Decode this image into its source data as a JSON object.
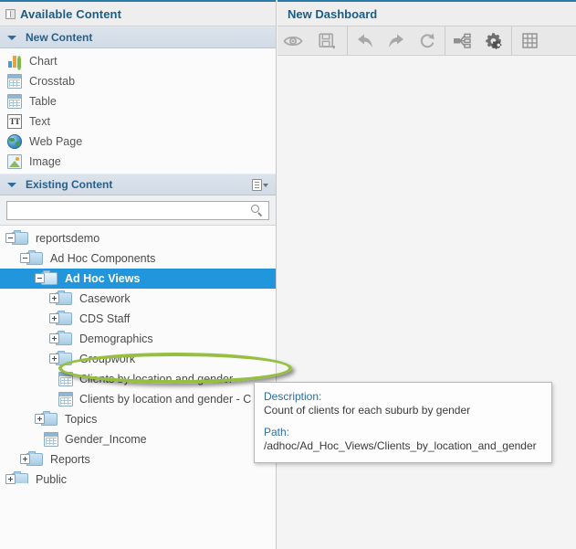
{
  "left_panel": {
    "title": "Available Content",
    "title_icon": "panel-collapse-icon",
    "new_content": {
      "header": "New Content",
      "items": [
        {
          "label": "Chart",
          "icon": "chart-icon"
        },
        {
          "label": "Crosstab",
          "icon": "crosstab-icon"
        },
        {
          "label": "Table",
          "icon": "table-icon"
        },
        {
          "label": "Text",
          "icon": "text-icon"
        },
        {
          "label": "Web Page",
          "icon": "web-page-icon"
        },
        {
          "label": "Image",
          "icon": "image-icon"
        }
      ]
    },
    "existing_content": {
      "header": "Existing Content",
      "options_icon": "list-options-icon",
      "search": {
        "value": "",
        "placeholder": "",
        "icon": "search-icon"
      },
      "tree": [
        {
          "label": "reportsdemo",
          "depth": 0,
          "type": "folder",
          "expander": "minus",
          "selected": false
        },
        {
          "label": "Ad Hoc Components",
          "depth": 1,
          "type": "folder",
          "expander": "minus",
          "selected": false
        },
        {
          "label": "Ad Hoc Views",
          "depth": 2,
          "type": "folder",
          "expander": "minus",
          "selected": true
        },
        {
          "label": "Casework",
          "depth": 3,
          "type": "folder",
          "expander": "plus",
          "selected": false
        },
        {
          "label": "CDS Staff",
          "depth": 3,
          "type": "folder",
          "expander": "plus",
          "selected": false
        },
        {
          "label": "Demographics",
          "depth": 3,
          "type": "folder",
          "expander": "plus",
          "selected": false
        },
        {
          "label": "Groupwork",
          "depth": 3,
          "type": "folder",
          "expander": "plus",
          "selected": false
        },
        {
          "label": "Clients by location and gender",
          "depth": 3,
          "type": "view",
          "expander": "none",
          "selected": false
        },
        {
          "label": "Clients by location and gender - C",
          "depth": 3,
          "type": "view",
          "expander": "none",
          "selected": false
        },
        {
          "label": "Topics",
          "depth": 2,
          "type": "folder",
          "expander": "plus",
          "selected": false
        },
        {
          "label": "Gender_Income",
          "depth": 2,
          "type": "view",
          "expander": "none",
          "selected": false
        },
        {
          "label": "Reports",
          "depth": 1,
          "type": "folder",
          "expander": "plus",
          "selected": false
        },
        {
          "label": "Public",
          "depth": 0,
          "type": "folder",
          "expander": "plus",
          "selected": false
        }
      ]
    }
  },
  "tooltip": {
    "description_label": "Description:",
    "description_value": "Count of clients for each suburb by gender",
    "path_label": "Path:",
    "path_value": "/adhoc/Ad_Hoc_Views/Clients_by_location_and_gender"
  },
  "annotation": {
    "shape": "ellipse-highlight",
    "color": "#96bf3f"
  },
  "right_panel": {
    "title": "New Dashboard",
    "toolbar": [
      {
        "name": "preview-button",
        "icon": "eye-icon",
        "group": 1
      },
      {
        "name": "save-button",
        "icon": "save-disk-icon",
        "group": 1
      },
      {
        "name": "undo-button",
        "icon": "undo-arrow-icon",
        "group": 2
      },
      {
        "name": "redo-button",
        "icon": "redo-arrow-icon",
        "group": 2
      },
      {
        "name": "reset-button",
        "icon": "refresh-icon",
        "group": 2
      },
      {
        "name": "hyperlinks-button",
        "icon": "connector-icon",
        "group": 3
      },
      {
        "name": "dashboard-properties-button",
        "icon": "gears-icon",
        "group": 3
      },
      {
        "name": "grid-toggle-button",
        "icon": "grid-icon",
        "group": 4
      }
    ]
  },
  "colors": {
    "accent_blue": "#2a7ba8",
    "selection_blue": "#2196dd",
    "annotation_green": "#96bf3f",
    "panel_bg": "#fbfbfb",
    "canvas_bg": "#f4f4f4"
  }
}
